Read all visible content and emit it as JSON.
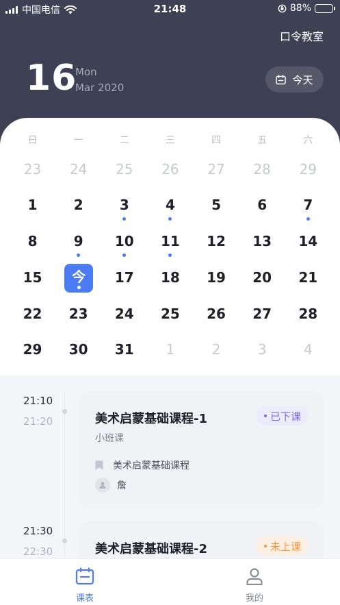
{
  "status_bar": {
    "carrier": "中国电信",
    "time": "21:48",
    "battery": "88%",
    "battery_level": 0.88
  },
  "header": {
    "top_link": "口令教室",
    "day_number": "16",
    "weekday": "Mon",
    "month_year": "Mar 2020",
    "today_button": "今天"
  },
  "calendar": {
    "weekdays": [
      "日",
      "一",
      "二",
      "三",
      "四",
      "五",
      "六"
    ],
    "weeks": [
      [
        {
          "d": "23",
          "m": true
        },
        {
          "d": "24",
          "m": true
        },
        {
          "d": "25",
          "m": true
        },
        {
          "d": "26",
          "m": true
        },
        {
          "d": "27",
          "m": true
        },
        {
          "d": "28",
          "m": true
        },
        {
          "d": "29",
          "m": true
        }
      ],
      [
        {
          "d": "1"
        },
        {
          "d": "2"
        },
        {
          "d": "3",
          "dot": true
        },
        {
          "d": "4",
          "dot": true
        },
        {
          "d": "5"
        },
        {
          "d": "6"
        },
        {
          "d": "7",
          "dot": true
        }
      ],
      [
        {
          "d": "8"
        },
        {
          "d": "9",
          "dot": true
        },
        {
          "d": "10",
          "dot": true
        },
        {
          "d": "11",
          "dot": true
        },
        {
          "d": "12"
        },
        {
          "d": "13"
        },
        {
          "d": "14"
        }
      ],
      [
        {
          "d": "15"
        },
        {
          "d": "今",
          "today": true
        },
        {
          "d": "17"
        },
        {
          "d": "18"
        },
        {
          "d": "19"
        },
        {
          "d": "20"
        },
        {
          "d": "21"
        }
      ],
      [
        {
          "d": "22"
        },
        {
          "d": "23"
        },
        {
          "d": "24"
        },
        {
          "d": "25"
        },
        {
          "d": "26"
        },
        {
          "d": "27"
        },
        {
          "d": "28"
        }
      ],
      [
        {
          "d": "29"
        },
        {
          "d": "30"
        },
        {
          "d": "31"
        },
        {
          "d": "1",
          "m": true
        },
        {
          "d": "2",
          "m": true
        },
        {
          "d": "3",
          "m": true
        },
        {
          "d": "4",
          "m": true
        }
      ]
    ],
    "accent_color": "#4b7cf3"
  },
  "schedule": [
    {
      "start": "21:10",
      "end": "21:20",
      "title": "美术启蒙基础课程-1",
      "type": "小班课",
      "status": "已下课",
      "course": "美术启蒙基础课程",
      "teacher": "詹"
    },
    {
      "start": "21:30",
      "end": "22:30",
      "title": "美术启蒙基础课程-2",
      "status": "未上课"
    }
  ],
  "tabs": [
    {
      "label": "课表",
      "icon": "calendar-icon",
      "active": true
    },
    {
      "label": "我的",
      "icon": "person-icon",
      "active": false
    }
  ]
}
